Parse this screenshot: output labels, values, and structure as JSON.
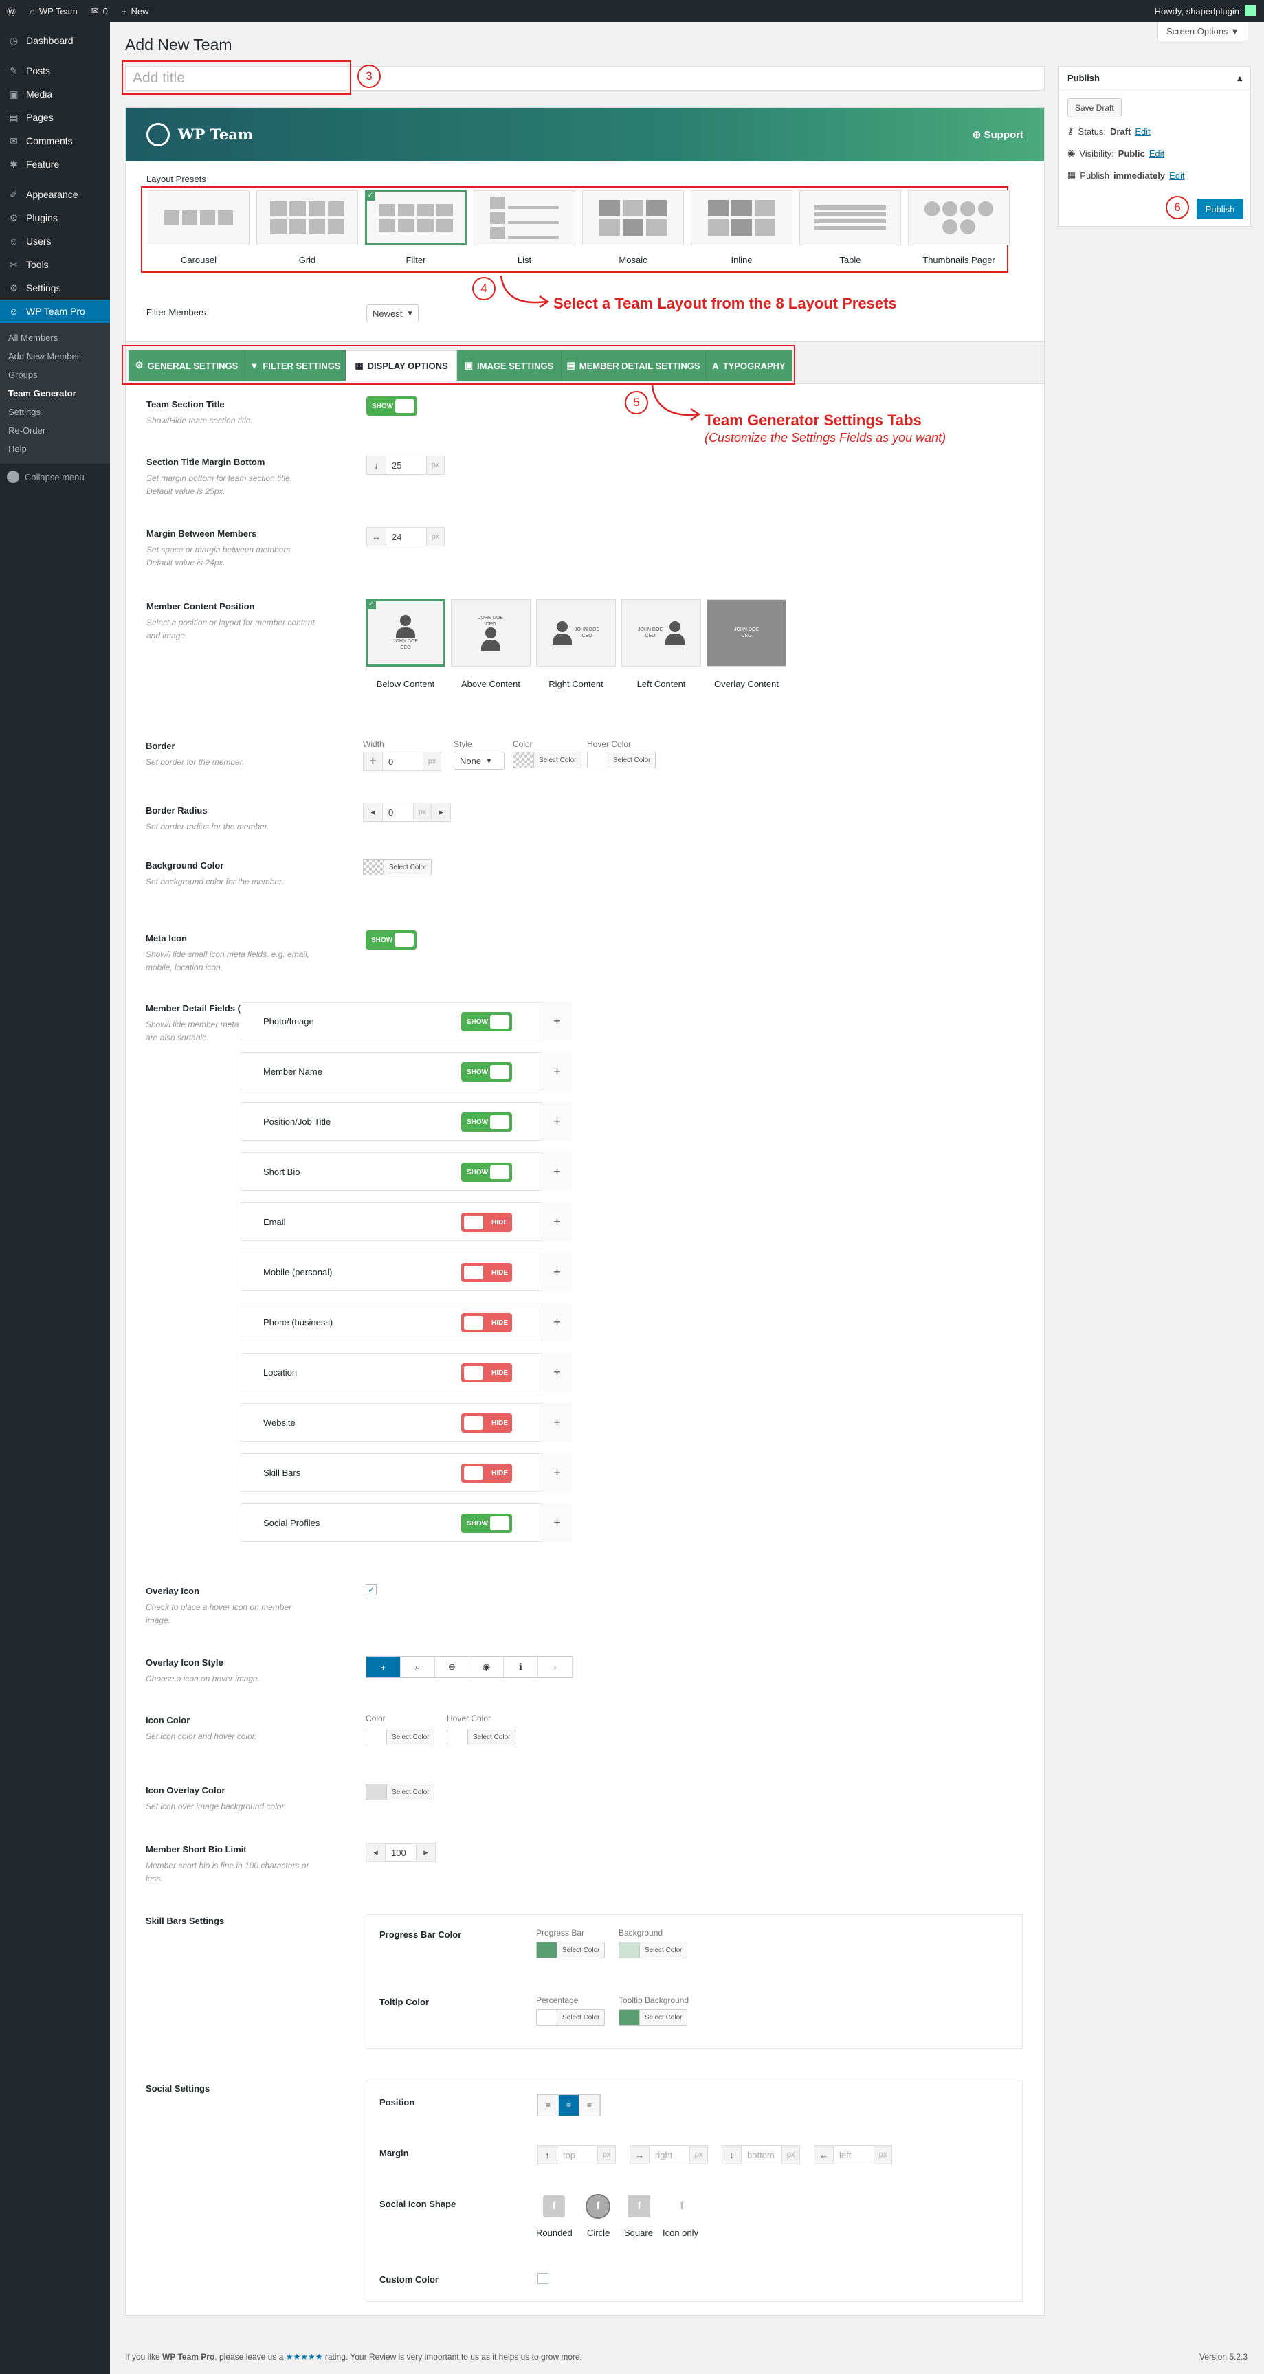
{
  "adminbar": {
    "site": "WP Team",
    "comments": "0",
    "new": "New",
    "howdy": "Howdy, shapedplugin"
  },
  "sidebar": {
    "items": [
      {
        "label": "Dashboard",
        "icon": "dashboard-icon",
        "glyph": "◷"
      },
      {
        "label": "Posts",
        "icon": "pin-icon",
        "glyph": "✎"
      },
      {
        "label": "Media",
        "icon": "media-icon",
        "glyph": "▣"
      },
      {
        "label": "Pages",
        "icon": "page-icon",
        "glyph": "▤"
      },
      {
        "label": "Comments",
        "icon": "comment-icon",
        "glyph": "✉"
      },
      {
        "label": "Feature",
        "icon": "feature-icon",
        "glyph": "✱"
      },
      {
        "label": "Appearance",
        "icon": "brush-icon",
        "glyph": "✐"
      },
      {
        "label": "Plugins",
        "icon": "plug-icon",
        "glyph": "⚙"
      },
      {
        "label": "Users",
        "icon": "users-icon",
        "glyph": "☺"
      },
      {
        "label": "Tools",
        "icon": "wrench-icon",
        "glyph": "✂"
      },
      {
        "label": "Settings",
        "icon": "settings-icon",
        "glyph": "⚙"
      },
      {
        "label": "WP Team Pro",
        "icon": "team-icon",
        "glyph": "☺"
      }
    ],
    "submenu": [
      "All Members",
      "Add New Member",
      "Groups",
      "Team Generator",
      "Settings",
      "Re-Order",
      "Help"
    ],
    "collapse": "Collapse menu"
  },
  "page": {
    "title": "Add New Team",
    "screen_options": "Screen Options ▼",
    "title_placeholder": "Add title"
  },
  "publish": {
    "heading": "Publish",
    "save_draft": "Save Draft",
    "status_label": "Status:",
    "status": "Draft",
    "visibility_label": "Visibility:",
    "visibility": "Public",
    "publish_label": "Publish",
    "publish_when": "immediately",
    "edit": "Edit",
    "publish_button": "Publish"
  },
  "banner": {
    "logo": "WP Team",
    "support": "Support"
  },
  "presets": {
    "label": "Layout Presets",
    "items": [
      "Carousel",
      "Grid",
      "Filter",
      "List",
      "Mosaic",
      "Inline",
      "Table",
      "Thumbnails Pager"
    ],
    "selected": "Filter"
  },
  "filter": {
    "label": "Filter Members",
    "value": "Newest"
  },
  "annotations": {
    "n3": "3",
    "n4": "4",
    "n5": "5",
    "n6": "6",
    "a4": "Select a Team Layout from the 8 Layout Presets",
    "a5": "Team Generator Settings Tabs",
    "a5sub": "(Customize the Settings Fields as you want)"
  },
  "tabs": [
    "GENERAL SETTINGS",
    "FILTER SETTINGS",
    "DISPLAY OPTIONS",
    "IMAGE SETTINGS",
    "MEMBER DETAIL SETTINGS",
    "TYPOGRAPHY"
  ],
  "fields": {
    "section_title": {
      "label": "Team Section Title",
      "desc": "Show/Hide team section title.",
      "toggle": "SHOW"
    },
    "title_margin": {
      "label": "Section Title Margin Bottom",
      "desc": "Set margin bottom for team section title. Default value is 25px.",
      "value": "25",
      "unit": "px"
    },
    "member_margin": {
      "label": "Margin Between Members",
      "desc": "Set space or margin between members. Default value is 24px.",
      "value": "24",
      "unit": "px"
    },
    "content_position": {
      "label": "Member Content Position",
      "desc": "Select a position or layout for member content and image.",
      "options": [
        "Below Content",
        "Above Content",
        "Right Content",
        "Left Content",
        "Overlay Content"
      ],
      "card_name": "JOHN DOE",
      "card_role": "CEO"
    },
    "border": {
      "label": "Border",
      "desc": "Set border for the member.",
      "width_label": "Width",
      "width": "0",
      "unit": "px",
      "style_label": "Style",
      "style": "None",
      "color_label": "Color",
      "hover_label": "Hover Color",
      "select_color": "Select Color"
    },
    "radius": {
      "label": "Border Radius",
      "desc": "Set border radius for the member.",
      "value": "0",
      "unit": "px"
    },
    "bg_color": {
      "label": "Background Color",
      "desc": "Set background color for the member.",
      "select_color": "Select Color"
    },
    "meta_icon": {
      "label": "Meta Icon",
      "desc": "Show/Hide small icon meta fields. e.g. email, mobile, location icon.",
      "toggle": "SHOW"
    },
    "detail_fields": {
      "label": "Member Detail Fields (Sortable)",
      "desc": "Show/Hide member meta fields. These fields are also sortable.",
      "rows": [
        {
          "name": "Photo/Image",
          "state": "SHOW"
        },
        {
          "name": "Member Name",
          "state": "SHOW"
        },
        {
          "name": "Position/Job Title",
          "state": "SHOW"
        },
        {
          "name": "Short Bio",
          "state": "SHOW"
        },
        {
          "name": "Email",
          "state": "HIDE"
        },
        {
          "name": "Mobile (personal)",
          "state": "HIDE"
        },
        {
          "name": "Phone (business)",
          "state": "HIDE"
        },
        {
          "name": "Location",
          "state": "HIDE"
        },
        {
          "name": "Website",
          "state": "HIDE"
        },
        {
          "name": "Skill Bars",
          "state": "HIDE"
        },
        {
          "name": "Social Profiles",
          "state": "SHOW"
        }
      ]
    },
    "overlay_icon": {
      "label": "Overlay Icon",
      "desc": "Check to place a hover icon on member image."
    },
    "overlay_style": {
      "label": "Overlay Icon Style",
      "desc": "Choose a icon on hover image.",
      "icons": [
        "+",
        "⌕",
        "⊕",
        "◉",
        "ℹ",
        "›"
      ]
    },
    "icon_color": {
      "label": "Icon Color",
      "desc": "Set icon color and hover color.",
      "color_label": "Color",
      "hover_label": "Hover Color",
      "select_color": "Select Color"
    },
    "icon_overlay": {
      "label": "Icon Overlay Color",
      "desc": "Set icon over image background color.",
      "select_color": "Select Color"
    },
    "bio_limit": {
      "label": "Member Short Bio Limit",
      "desc": "Member short bio is fine in 100 characters or less.",
      "value": "100"
    },
    "skill_bars": {
      "label": "Skill Bars Settings",
      "progress_label": "Progress Bar Color",
      "progress_bar": "Progress Bar",
      "background": "Background",
      "tooltip_label": "Toltip Color",
      "percentage": "Percentage",
      "tooltip_bg": "Tooltip Background",
      "select_color": "Select Color"
    },
    "social": {
      "label": "Social Settings",
      "position": "Position",
      "margin": "Margin",
      "top": "top",
      "right": "right",
      "bottom": "bottom",
      "left": "left",
      "unit": "px",
      "shape_label": "Social Icon Shape",
      "shapes": [
        "Rounded",
        "Circle",
        "Square",
        "Icon only"
      ],
      "custom_color": "Custom Color"
    }
  },
  "footer": {
    "pre": "If you like",
    "plugin": "WP Team Pro",
    "mid": ", please leave us a",
    "stars": "★★★★★",
    "post": "rating. Your Review is very important to us as it helps us to grow more.",
    "version": "Version 5.2.3"
  },
  "colors": {
    "accent": "#4a9e6c",
    "wp_blue": "#0073aa",
    "annotation_red": "#e02020",
    "show": "#4caf50",
    "hide": "#e96060"
  }
}
